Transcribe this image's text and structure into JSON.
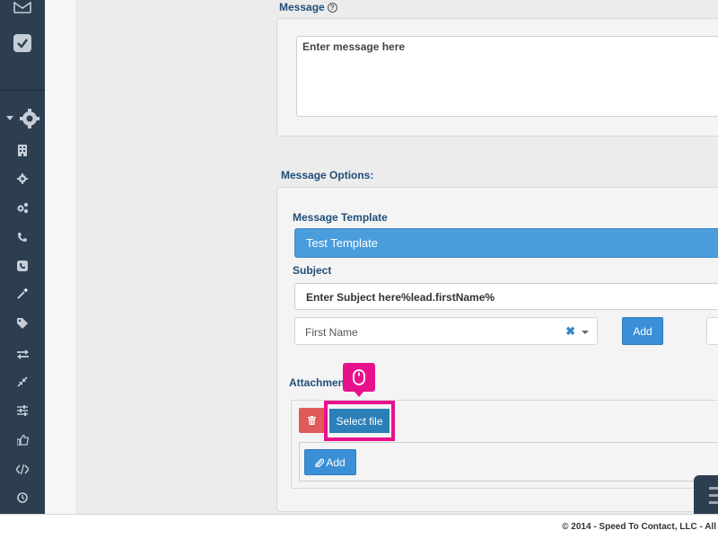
{
  "message": {
    "label": "Message",
    "help_glyph": "?",
    "placeholder": "Enter message here"
  },
  "options": {
    "section_label": "Message Options:",
    "template_label": "Message Template",
    "template_value": "Test Template",
    "subject_label": "Subject",
    "subject_value": "Enter Subject here%lead.firstName%",
    "field_select_value": "First Name",
    "field_clear_glyph": "✖",
    "add_field_label": "Add"
  },
  "attachments": {
    "label": "Attachment",
    "select_file_label": "Select file",
    "add_label": "Add"
  },
  "footer": {
    "text": "© 2014 - Speed To Contact, LLC - All"
  },
  "sidebar": {
    "icons": [
      "mail-icon",
      "checklist-icon",
      "settings-gear-icon",
      "building-icon",
      "gear-icon",
      "gears-icon",
      "phone-icon",
      "phone-square-icon",
      "magic-wand-icon",
      "tag-icon",
      "exchange-icon",
      "compress-icon",
      "sliders-icon",
      "thumbs-up-icon",
      "code-icon",
      "clock-icon"
    ]
  },
  "colors": {
    "sidebar": "#2d3e50",
    "accent_blue": "#3a8fd6",
    "template_blue": "#4a9ddc",
    "label_blue": "#214e78",
    "danger_red": "#e05a5a",
    "highlight_pink": "#e8118c"
  }
}
